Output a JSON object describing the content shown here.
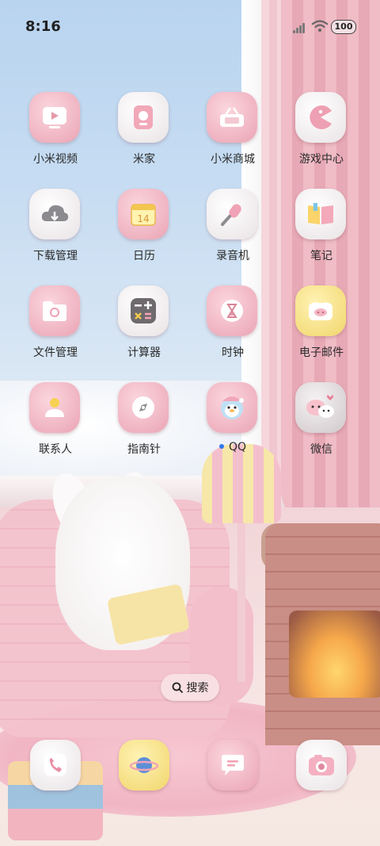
{
  "status_bar": {
    "time": "8:16",
    "battery": "100"
  },
  "apps": [
    {
      "label": "小米视频",
      "icon": "video-play-icon"
    },
    {
      "label": "米家",
      "icon": "smart-home-icon"
    },
    {
      "label": "小米商城",
      "icon": "shopping-basket-icon"
    },
    {
      "label": "游戏中心",
      "icon": "game-pacman-icon"
    },
    {
      "label": "下载管理",
      "icon": "cloud-download-icon"
    },
    {
      "label": "日历",
      "icon": "calendar-icon",
      "day": "14"
    },
    {
      "label": "录音机",
      "icon": "microphone-icon"
    },
    {
      "label": "笔记",
      "icon": "notebook-icon"
    },
    {
      "label": "文件管理",
      "icon": "folder-icon"
    },
    {
      "label": "计算器",
      "icon": "calculator-icon"
    },
    {
      "label": "时钟",
      "icon": "hourglass-icon"
    },
    {
      "label": "电子邮件",
      "icon": "mail-icon"
    },
    {
      "label": "联系人",
      "icon": "contacts-icon"
    },
    {
      "label": "指南针",
      "icon": "compass-icon"
    },
    {
      "label": "QQ",
      "icon": "qq-penguin-icon",
      "badge_dot": true
    },
    {
      "label": "微信",
      "icon": "wechat-icon"
    }
  ],
  "search": {
    "label": "搜索",
    "icon": "search-icon"
  },
  "dock": [
    {
      "name": "phone",
      "icon": "phone-icon"
    },
    {
      "name": "browser",
      "icon": "planet-icon"
    },
    {
      "name": "messages",
      "icon": "message-bubble-icon"
    },
    {
      "name": "camera",
      "icon": "camera-icon"
    }
  ],
  "colors": {
    "accent_pink": "#eaa4b4",
    "qq_dot": "#2f78ef",
    "label_text": "#2a2a2a"
  }
}
